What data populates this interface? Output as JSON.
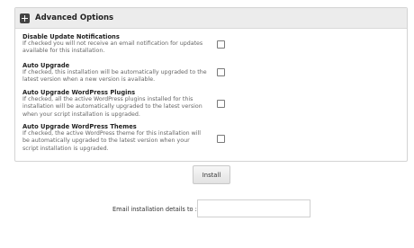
{
  "panel": {
    "title": "Advanced Options",
    "options": [
      {
        "title": "Disable Update Notifications",
        "desc_lines": [
          "If checked you will not receive an email notification for updates",
          "available for this installation."
        ],
        "checked": false
      },
      {
        "title": "Auto Upgrade",
        "desc_lines": [
          "If checked, this installation will be automatically upgraded to the",
          "latest version when a new version is available."
        ],
        "checked": false
      },
      {
        "title": "Auto Upgrade WordPress Plugins",
        "desc_lines": [
          "If checked, all the active WordPress plugins installed for this",
          "installation will be automatically upgraded to the latest version",
          "when your script installation is upgraded."
        ],
        "checked": false
      },
      {
        "title": "Auto Upgrade WordPress Themes",
        "desc_lines": [
          "If checked, the active WordPress theme for this installation will",
          "be automatically upgraded to the latest version when your",
          "script installation is upgraded."
        ],
        "checked": false
      }
    ]
  },
  "install_label": "Install",
  "email": {
    "label": "Email installation details to :",
    "value": ""
  }
}
